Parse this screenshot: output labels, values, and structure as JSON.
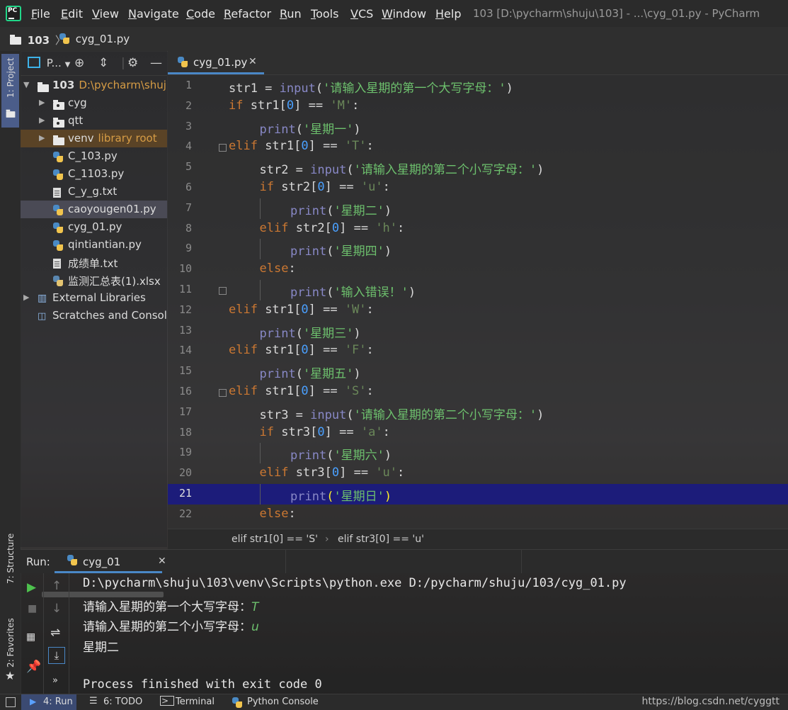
{
  "app": {
    "window_title": "103 [D:\\pycharm\\shuju\\103] - ...\\cyg_01.py - PyCharm",
    "logo_text": "PC"
  },
  "menu": [
    "File",
    "Edit",
    "View",
    "Navigate",
    "Code",
    "Refactor",
    "Run",
    "Tools",
    "VCS",
    "Window",
    "Help"
  ],
  "menu_mnemonics": [
    "F",
    "E",
    "V",
    "N",
    "C",
    "R",
    "R",
    "T",
    "V",
    "W",
    "H"
  ],
  "navbar": {
    "project": "103",
    "file": "cyg_01.py"
  },
  "left_stripe": {
    "project": "1: Project",
    "structure": "7: Structure",
    "favorites": "2: Favorites"
  },
  "project_panel": {
    "title": "P...",
    "tree": [
      {
        "label": "103",
        "hint": "D:\\pycharm\\shuju",
        "type": "folder",
        "level": 0,
        "expanded": true
      },
      {
        "label": "cyg",
        "type": "folder",
        "level": 1
      },
      {
        "label": "qtt",
        "type": "folder",
        "level": 1
      },
      {
        "label": "venv",
        "hint": "library root",
        "type": "folder",
        "level": 1
      },
      {
        "label": "C_103.py",
        "type": "py",
        "level": 1
      },
      {
        "label": "C_1103.py",
        "type": "py",
        "level": 1
      },
      {
        "label": "C_y_g.txt",
        "type": "txt",
        "level": 1
      },
      {
        "label": "caoyougen01.py",
        "type": "py",
        "level": 1,
        "selected": true
      },
      {
        "label": "cyg_01.py",
        "type": "py",
        "level": 1
      },
      {
        "label": "qintiantian.py",
        "type": "py",
        "level": 1
      },
      {
        "label": "成绩单.txt",
        "type": "txt",
        "level": 1
      },
      {
        "label": "监测汇总表(1).xlsx",
        "type": "xlsx",
        "level": 1
      },
      {
        "label": "External Libraries",
        "type": "lib",
        "level": 0
      },
      {
        "label": "Scratches and Consoles",
        "type": "scratch",
        "level": 0
      }
    ]
  },
  "editor": {
    "tab": "cyg_01.py",
    "current_line": 21,
    "lines": [
      "str1 = input('请输入星期的第一个大写字母：')",
      "if str1[0] == 'M':",
      "    print('星期一')",
      "elif str1[0] == 'T':",
      "    str2 = input('请输入星期的第二个小写字母：')",
      "    if str2[0] == 'u':",
      "        print('星期二')",
      "    elif str2[0] == 'h':",
      "        print('星期四')",
      "    else:",
      "        print('输入错误！')",
      "elif str1[0] == 'W':",
      "    print('星期三')",
      "elif str1[0] == 'F':",
      "    print('星期五')",
      "elif str1[0] == 'S':",
      "    str3 = input('请输入星期的第二个小写字母：')",
      "    if str3[0] == 'a':",
      "        print('星期六')",
      "    elif str3[0] == 'u':",
      "        print('星期日')",
      "    else:"
    ],
    "breadcrumb": [
      "elif str1[0] == 'S'",
      "elif str3[0] == 'u'"
    ]
  },
  "run_panel": {
    "title": "Run:",
    "tab": "cyg_01",
    "console": [
      {
        "text": "D:\\pycharm\\shuju\\103\\venv\\Scripts\\python.exe D:/pycharm/shuju/103/cyg_01.py",
        "input": ""
      },
      {
        "text": "请输入星期的第一个大写字母：",
        "input": "T"
      },
      {
        "text": "请输入星期的第二个小写字母：",
        "input": "u"
      },
      {
        "text": "星期二",
        "input": ""
      },
      {
        "text": "",
        "input": ""
      },
      {
        "text": "Process finished with exit code 0",
        "input": ""
      }
    ]
  },
  "bottom_bar": {
    "run": "4: Run",
    "todo": "6: TODO",
    "terminal": "Terminal",
    "python_console": "Python Console",
    "watermark": "https://blog.csdn.net/cyggtt"
  },
  "colors": {
    "keyword": "#cc7832",
    "builtin": "#8888c6",
    "string": "#6a8759",
    "number": "#4aa0ff",
    "current_line": "#1c1c7a",
    "accent": "#4a88c7"
  }
}
